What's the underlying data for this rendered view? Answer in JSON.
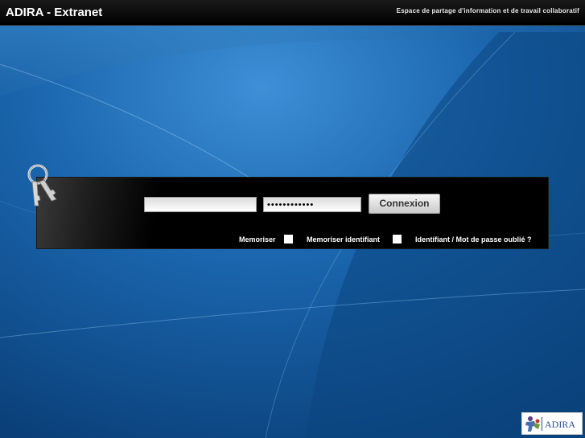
{
  "header": {
    "app_title": "ADIRA - Extranet",
    "tagline": "Espace de partage d'information et de travail collaboratif"
  },
  "login": {
    "username_value": "",
    "password_value": "••••••••••••",
    "connect_label": "Connexion",
    "remember_label": "Memoriser",
    "remember_id_label": "Memoriser identifiant",
    "forgot_label": "Identifiant / Mot de passe oublié ?"
  },
  "footer": {
    "logo_text": "ADIRA"
  },
  "icons": {
    "keys": "keys-icon",
    "logo_figure": "adira-figure-icon"
  },
  "colors": {
    "background_blue": "#0d4f8f",
    "panel_black": "#000000",
    "accent_text": "#ffffff",
    "logo_blue": "#2a4f8a"
  }
}
